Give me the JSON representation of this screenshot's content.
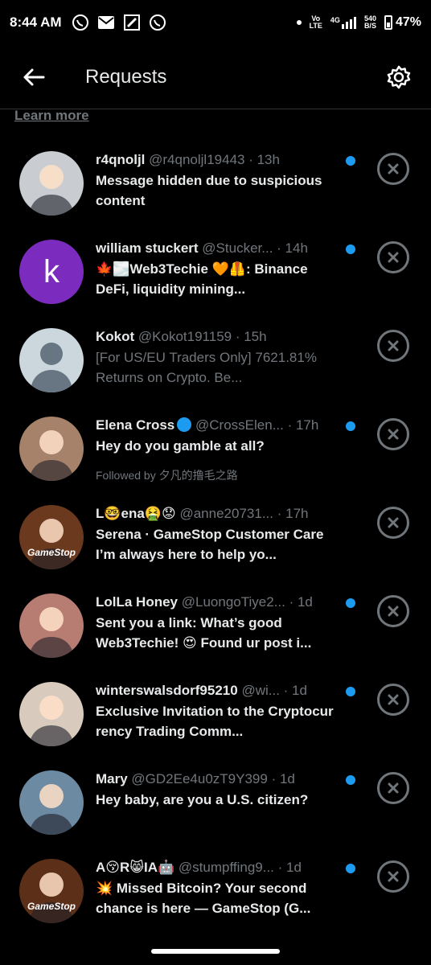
{
  "status_bar": {
    "time": "8:44 AM",
    "network_top": "Vo",
    "network_bottom": "LTE",
    "network_type": "4G",
    "speed_top": "540",
    "speed_bottom": "B/S",
    "battery": "47%",
    "battery_level": 0.47
  },
  "header": {
    "title": "Requests"
  },
  "learn_more": "Learn more",
  "requests": [
    {
      "name": "r4qnoljl",
      "handle": "@r4qnoljl19443",
      "time": "· 13h",
      "message": "Message hidden due to suspicious content",
      "unread": true,
      "avatar_color": "#c9cdd2"
    },
    {
      "name": "william stuckert",
      "handle": "@Stucker...",
      "time": "· 14h",
      "message": "🍁🌫️Web3Techie 🧡🦺: Binance DeFi, liquidity mining...",
      "unread": true,
      "avatar_letter": "k",
      "avatar_color": "#7b2cbf"
    },
    {
      "name": "Kokot",
      "handle": "@Kokot191159",
      "time": "· 15h",
      "message": "[For US/EU Traders Only] 7621.81% Returns on Crypto. Be...",
      "unread": false,
      "avatar_color": "#ccd6dd"
    },
    {
      "name": "Elena Cross",
      "handle": "@CrossElen...",
      "time": "· 17h",
      "message": "Hey do you gamble at all?",
      "followed": "Followed by 夕凡的撸毛之路",
      "unread": true,
      "avatar_color": "#a7826a"
    },
    {
      "name": "L🤓ena🤮😟",
      "handle": "@anne20731...",
      "time": "· 17h",
      "message": "Serena · GameStop Customer Care  I’m always here to help yo...",
      "unread": false,
      "avatar_color": "#6b3a1e",
      "avatar_text": "GameStop"
    },
    {
      "name": "LolLa Honey",
      "handle": "@LuongoTiye2...",
      "time": "· 1d",
      "message": "Sent you a link: What’s good Web3Techie! 😍 Found ur post i...",
      "unread": true,
      "avatar_color": "#b87d72"
    },
    {
      "name": "winterswalsdorf95210",
      "handle": "@wi...",
      "time": "· 1d",
      "message": "Exclusive Invitation to the Cryptocur rency Trading Comm...",
      "unread": true,
      "avatar_color": "#d8cbbd"
    },
    {
      "name": "Mary",
      "handle": "@GD2Ee4u0zT9Y399",
      "time": "· 1d",
      "message": "Hey baby, are you a U.S. citizen?",
      "unread": true,
      "avatar_color": "#6d8aa3"
    },
    {
      "name": "A😚R😸IA🤖",
      "handle": "@stumpffing9...",
      "time": "· 1d",
      "message": "💥 Missed Bitcoin? Your second chance is here — GameStop (G...",
      "unread": true,
      "avatar_color": "#5c3018",
      "avatar_text": "GameStop"
    }
  ]
}
